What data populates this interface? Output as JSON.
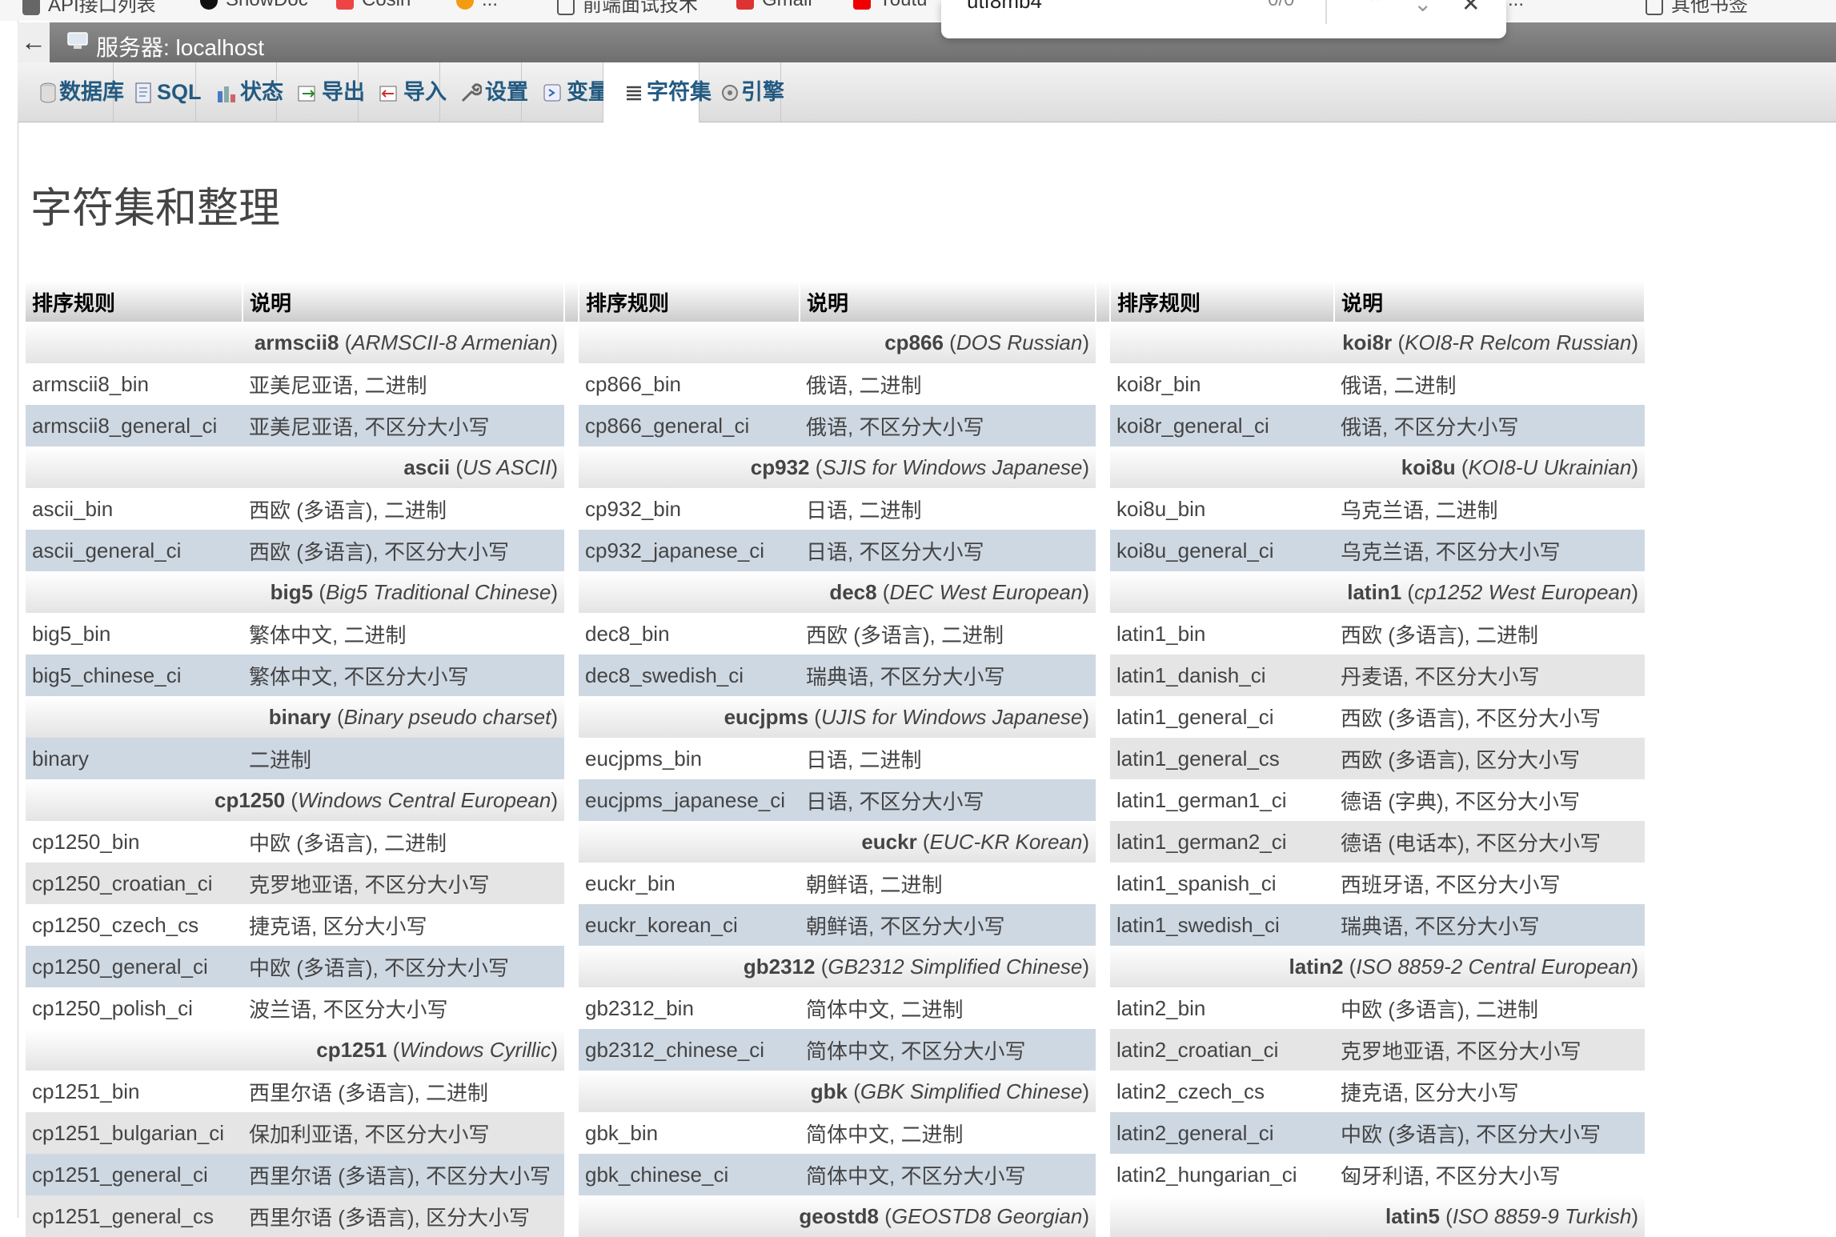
{
  "browser": {
    "bookmarks": [
      "API接口列表",
      "ShowDoc",
      "Cosin",
      "...",
      "前端面试技术",
      "Gmail",
      "Youtu",
      "...",
      "其他书签"
    ],
    "find": {
      "query": "utf8mb4",
      "count": "0/0"
    }
  },
  "server": {
    "label": "服务器: localhost"
  },
  "tabs": [
    {
      "label": "数据库",
      "icon": "database-icon"
    },
    {
      "label": "SQL",
      "icon": "sql-icon"
    },
    {
      "label": "状态",
      "icon": "status-chart-icon"
    },
    {
      "label": "导出",
      "icon": "export-icon"
    },
    {
      "label": "导入",
      "icon": "import-icon"
    },
    {
      "label": "设置",
      "icon": "wrench-icon"
    },
    {
      "label": "变量",
      "icon": "variables-icon"
    },
    {
      "label": "字符集",
      "icon": "charset-list-icon",
      "active": true
    },
    {
      "label": "引擎",
      "icon": "engine-icon"
    }
  ],
  "page": {
    "title": "字符集和整理"
  },
  "table": {
    "headers": [
      "排序规则",
      "说明",
      "排序规则",
      "说明",
      "排序规则",
      "说明"
    ],
    "rows": [
      [
        {
          "cs": "armscii8",
          "desc": "ARMSCII-8 Armenian"
        },
        {
          "cs": "cp866",
          "desc": "DOS Russian"
        },
        {
          "cs": "koi8r",
          "desc": "KOI8-R Relcom Russian"
        }
      ],
      [
        {
          "c": "armscii8_bin",
          "d": "亚美尼亚语, 二进制",
          "s": "odd"
        },
        {
          "c": "cp866_bin",
          "d": "俄语, 二进制",
          "s": "odd"
        },
        {
          "c": "koi8r_bin",
          "d": "俄语, 二进制",
          "s": "odd"
        }
      ],
      [
        {
          "c": "armscii8_general_ci",
          "d": "亚美尼亚语, 不区分大小写",
          "s": "hl"
        },
        {
          "c": "cp866_general_ci",
          "d": "俄语, 不区分大小写",
          "s": "hl"
        },
        {
          "c": "koi8r_general_ci",
          "d": "俄语, 不区分大小写",
          "s": "hl"
        }
      ],
      [
        {
          "cs": "ascii",
          "desc": "US ASCII"
        },
        {
          "cs": "cp932",
          "desc": "SJIS for Windows Japanese"
        },
        {
          "cs": "koi8u",
          "desc": "KOI8-U Ukrainian"
        }
      ],
      [
        {
          "c": "ascii_bin",
          "d": "西欧 (多语言), 二进制",
          "s": "odd"
        },
        {
          "c": "cp932_bin",
          "d": "日语, 二进制",
          "s": "odd"
        },
        {
          "c": "koi8u_bin",
          "d": "乌克兰语, 二进制",
          "s": "odd"
        }
      ],
      [
        {
          "c": "ascii_general_ci",
          "d": "西欧 (多语言), 不区分大小写",
          "s": "hl"
        },
        {
          "c": "cp932_japanese_ci",
          "d": "日语, 不区分大小写",
          "s": "hl"
        },
        {
          "c": "koi8u_general_ci",
          "d": "乌克兰语, 不区分大小写",
          "s": "hl"
        }
      ],
      [
        {
          "cs": "big5",
          "desc": "Big5 Traditional Chinese"
        },
        {
          "cs": "dec8",
          "desc": "DEC West European"
        },
        {
          "cs": "latin1",
          "desc": "cp1252 West European"
        }
      ],
      [
        {
          "c": "big5_bin",
          "d": "繁体中文, 二进制",
          "s": "odd"
        },
        {
          "c": "dec8_bin",
          "d": "西欧 (多语言), 二进制",
          "s": "odd"
        },
        {
          "c": "latin1_bin",
          "d": "西欧 (多语言), 二进制",
          "s": "odd"
        }
      ],
      [
        {
          "c": "big5_chinese_ci",
          "d": "繁体中文, 不区分大小写",
          "s": "hl"
        },
        {
          "c": "dec8_swedish_ci",
          "d": "瑞典语, 不区分大小写",
          "s": "hl"
        },
        {
          "c": "latin1_danish_ci",
          "d": "丹麦语, 不区分大小写",
          "s": "even"
        }
      ],
      [
        {
          "cs": "binary",
          "desc": "Binary pseudo charset"
        },
        {
          "cs": "eucjpms",
          "desc": "UJIS for Windows Japanese"
        },
        {
          "c": "latin1_general_ci",
          "d": "西欧 (多语言), 不区分大小写",
          "s": "odd"
        }
      ],
      [
        {
          "c": "binary",
          "d": "二进制",
          "s": "hl"
        },
        {
          "c": "eucjpms_bin",
          "d": "日语, 二进制",
          "s": "odd"
        },
        {
          "c": "latin1_general_cs",
          "d": "西欧 (多语言), 区分大小写",
          "s": "even"
        }
      ],
      [
        {
          "cs": "cp1250",
          "desc": "Windows Central European"
        },
        {
          "c": "eucjpms_japanese_ci",
          "d": "日语, 不区分大小写",
          "s": "hl"
        },
        {
          "c": "latin1_german1_ci",
          "d": "德语 (字典), 不区分大小写",
          "s": "odd"
        }
      ],
      [
        {
          "c": "cp1250_bin",
          "d": "中欧 (多语言), 二进制",
          "s": "odd"
        },
        {
          "cs": "euckr",
          "desc": "EUC-KR Korean"
        },
        {
          "c": "latin1_german2_ci",
          "d": "德语 (电话本), 不区分大小写",
          "s": "even"
        }
      ],
      [
        {
          "c": "cp1250_croatian_ci",
          "d": "克罗地亚语, 不区分大小写",
          "s": "even"
        },
        {
          "c": "euckr_bin",
          "d": "朝鲜语, 二进制",
          "s": "odd"
        },
        {
          "c": "latin1_spanish_ci",
          "d": "西班牙语, 不区分大小写",
          "s": "odd"
        }
      ],
      [
        {
          "c": "cp1250_czech_cs",
          "d": "捷克语, 区分大小写",
          "s": "odd"
        },
        {
          "c": "euckr_korean_ci",
          "d": "朝鲜语, 不区分大小写",
          "s": "hl"
        },
        {
          "c": "latin1_swedish_ci",
          "d": "瑞典语, 不区分大小写",
          "s": "hl"
        }
      ],
      [
        {
          "c": "cp1250_general_ci",
          "d": "中欧 (多语言), 不区分大小写",
          "s": "hl"
        },
        {
          "cs": "gb2312",
          "desc": "GB2312 Simplified Chinese"
        },
        {
          "cs": "latin2",
          "desc": "ISO 8859-2 Central European"
        }
      ],
      [
        {
          "c": "cp1250_polish_ci",
          "d": "波兰语, 不区分大小写",
          "s": "odd"
        },
        {
          "c": "gb2312_bin",
          "d": "简体中文, 二进制",
          "s": "odd"
        },
        {
          "c": "latin2_bin",
          "d": "中欧 (多语言), 二进制",
          "s": "odd"
        }
      ],
      [
        {
          "cs": "cp1251",
          "desc": "Windows Cyrillic"
        },
        {
          "c": "gb2312_chinese_ci",
          "d": "简体中文, 不区分大小写",
          "s": "hl"
        },
        {
          "c": "latin2_croatian_ci",
          "d": "克罗地亚语, 不区分大小写",
          "s": "even"
        }
      ],
      [
        {
          "c": "cp1251_bin",
          "d": "西里尔语 (多语言), 二进制",
          "s": "odd"
        },
        {
          "cs": "gbk",
          "desc": "GBK Simplified Chinese"
        },
        {
          "c": "latin2_czech_cs",
          "d": "捷克语, 区分大小写",
          "s": "odd"
        }
      ],
      [
        {
          "c": "cp1251_bulgarian_ci",
          "d": "保加利亚语, 不区分大小写",
          "s": "even"
        },
        {
          "c": "gbk_bin",
          "d": "简体中文, 二进制",
          "s": "odd"
        },
        {
          "c": "latin2_general_ci",
          "d": "中欧 (多语言), 不区分大小写",
          "s": "hl"
        }
      ],
      [
        {
          "c": "cp1251_general_ci",
          "d": "西里尔语 (多语言), 不区分大小写",
          "s": "hl"
        },
        {
          "c": "gbk_chinese_ci",
          "d": "简体中文, 不区分大小写",
          "s": "hl"
        },
        {
          "c": "latin2_hungarian_ci",
          "d": "匈牙利语, 不区分大小写",
          "s": "odd"
        }
      ],
      [
        {
          "c": "cp1251_general_cs",
          "d": "西里尔语 (多语言), 区分大小写",
          "s": "even"
        },
        {
          "cs": "geostd8",
          "desc": "GEOSTD8 Georgian"
        },
        {
          "cs": "latin5",
          "desc": "ISO 8859-9 Turkish"
        }
      ]
    ]
  }
}
